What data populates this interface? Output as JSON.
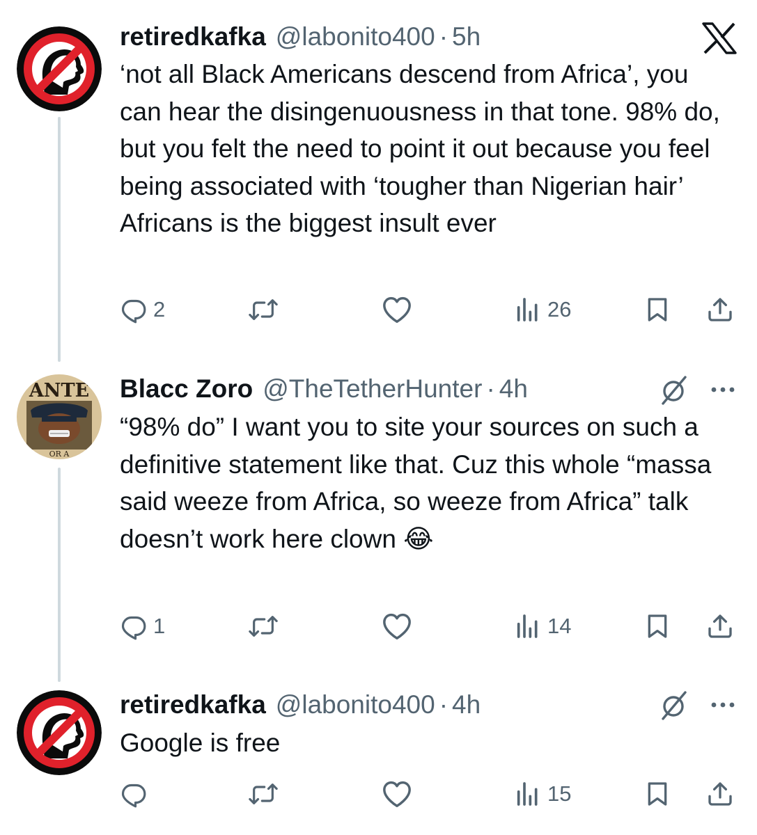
{
  "tweets": [
    {
      "name": "retiredkafka",
      "handle": "@labonito400",
      "dot": "·",
      "time": "5h",
      "text": "‘not all Black Americans descend from Africa’, you can hear the disingenuousness in that tone. 98% do, but you felt the need to point it out because you feel being associated with ‘tougher than Nigerian hair’ Africans is the biggest insult ever",
      "replies": "2",
      "reposts": "",
      "likes": "",
      "views": "26",
      "avatar_icon": "no-person-icon"
    },
    {
      "name": "Blacc Zoro",
      "handle": "@TheTetherHunter",
      "dot": "·",
      "time": "4h",
      "text": "“98% do” I want you to site your sources on such a definitive statement like that. Cuz this whole “massa said weeze from Africa, so weeze from Africa” talk doesn’t work here clown 😂",
      "replies": "1",
      "reposts": "",
      "likes": "",
      "views": "14",
      "avatar_icon": "wanted-poster-avatar",
      "avatar_text_top": "ANTE",
      "avatar_text_bottom": "OR A"
    },
    {
      "name": "retiredkafka",
      "handle": "@labonito400",
      "dot": "·",
      "time": "4h",
      "text": "Google is free",
      "replies": "",
      "reposts": "",
      "likes": "",
      "views": "15",
      "avatar_icon": "no-person-icon"
    }
  ],
  "colors": {
    "text": "#0f1419",
    "muted": "#536471",
    "thread": "#cfd9de",
    "ban_red": "#e0212b"
  }
}
